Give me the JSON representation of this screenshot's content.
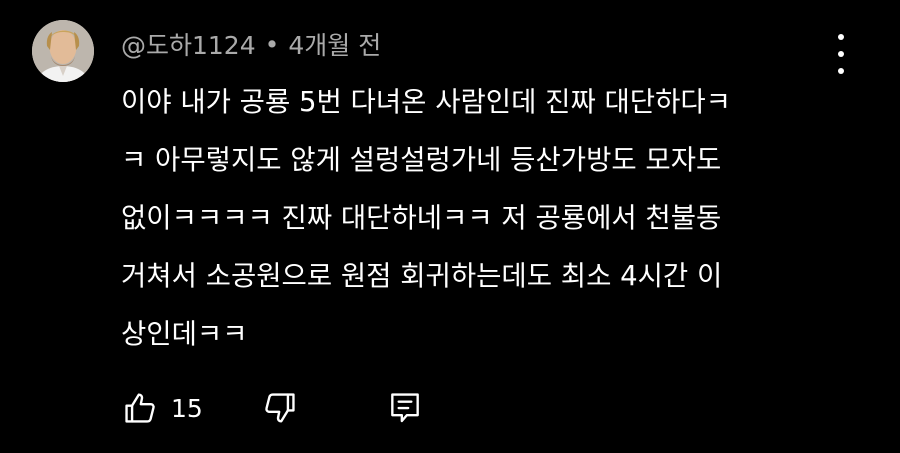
{
  "comment": {
    "author": "@도하1124",
    "separator": "•",
    "time": "4개월 전",
    "text": "이야 내가 공룡 5번 다녀온 사람인데 진짜 대단하다ㅋ\nㅋ 아무렇지도 않게 설렁설렁가네 등산가방도 모자도\n없이ㅋㅋㅋㅋ 진짜 대단하네ㅋㅋ 저 공룡에서 천불동\n거쳐서 소공원으로 원점 회귀하는데도 최소 4시간 이\n상인데ㅋㅋ",
    "likes": "15",
    "icons": {
      "avatar": "user-avatar",
      "more": "more-vert-icon",
      "like": "thumb-up-icon",
      "dislike": "thumb-down-icon",
      "reply": "reply-comment-icon"
    },
    "colors": {
      "background": "#000000",
      "text": "#ffffff",
      "meta": "#aaaaaa"
    }
  }
}
